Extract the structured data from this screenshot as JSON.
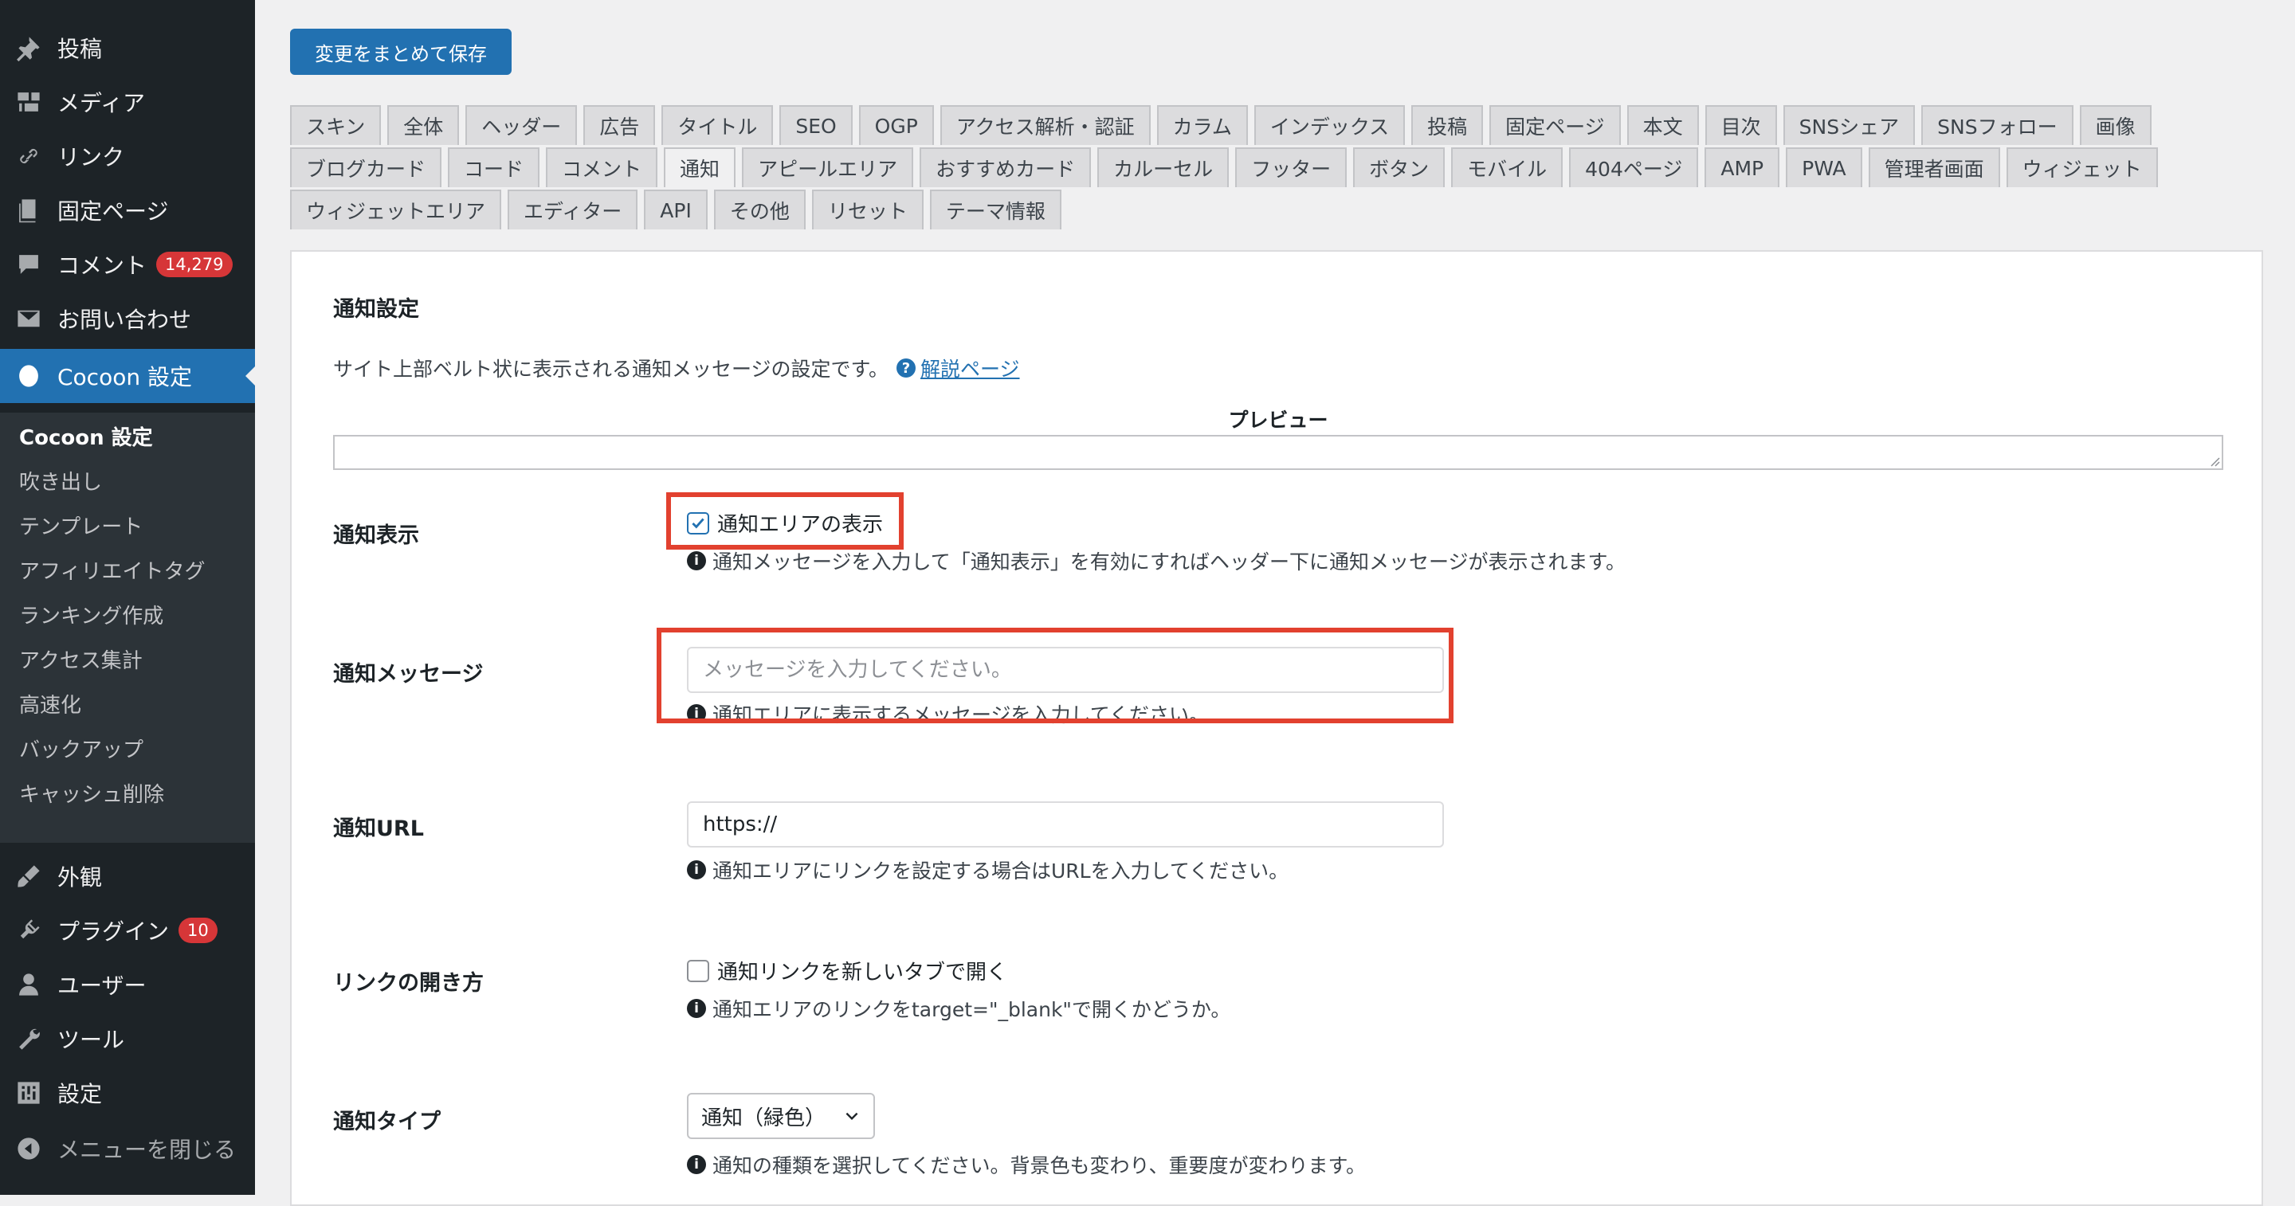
{
  "sidebar": {
    "items": [
      {
        "label": "投稿",
        "icon": "pin-icon"
      },
      {
        "label": "メディア",
        "icon": "media-icon"
      },
      {
        "label": "リンク",
        "icon": "link-icon"
      },
      {
        "label": "固定ページ",
        "icon": "page-icon"
      },
      {
        "label": "コメント",
        "icon": "comment-icon",
        "badge": "14,279"
      },
      {
        "label": "お問い合わせ",
        "icon": "mail-icon"
      },
      {
        "label": "Cocoon 設定",
        "icon": "cocoon-icon",
        "active": true
      }
    ],
    "submenu": [
      "Cocoon 設定",
      "吹き出し",
      "テンプレート",
      "アフィリエイトタグ",
      "ランキング作成",
      "アクセス集計",
      "高速化",
      "バックアップ",
      "キャッシュ削除"
    ],
    "bottom_items": [
      {
        "label": "外観",
        "icon": "brush-icon"
      },
      {
        "label": "プラグイン",
        "icon": "plugin-icon",
        "badge": "10"
      },
      {
        "label": "ユーザー",
        "icon": "user-icon"
      },
      {
        "label": "ツール",
        "icon": "wrench-icon"
      },
      {
        "label": "設定",
        "icon": "settings-icon"
      },
      {
        "label": "メニューを閉じる",
        "icon": "collapse-icon"
      }
    ]
  },
  "save_button": "変更をまとめて保存",
  "tabs": {
    "row1": [
      "スキン",
      "全体",
      "ヘッダー",
      "広告",
      "タイトル",
      "SEO",
      "OGP",
      "アクセス解析・認証",
      "カラム",
      "インデックス",
      "投稿",
      "固定ページ",
      "本文",
      "目次",
      "SNSシェア",
      "SNSフォロー",
      "画像"
    ],
    "row2": [
      "ブログカード",
      "コード",
      "コメント",
      "通知",
      "アピールエリア",
      "おすすめカード",
      "カルーセル",
      "フッター",
      "ボタン",
      "モバイル",
      "404ページ",
      "AMP",
      "PWA",
      "管理者画面",
      "ウィジェット"
    ],
    "row3": [
      "ウィジェットエリア",
      "エディター",
      "API",
      "その他",
      "リセット",
      "テーマ情報"
    ],
    "active": "通知"
  },
  "panel": {
    "title": "通知設定",
    "description": "サイト上部ベルト状に表示される通知メッセージの設定です。",
    "help_icon": "?",
    "help_link": "解説ページ",
    "preview_label": "プレビュー",
    "info_icon": "i",
    "notice_display": {
      "label": "通知表示",
      "checkbox_label": "通知エリアの表示",
      "checked": true,
      "hint": "通知メッセージを入力して「通知表示」を有効にすればヘッダー下に通知メッセージが表示されます。"
    },
    "notice_message": {
      "label": "通知メッセージ",
      "placeholder": "メッセージを入力してください。",
      "hint": "通知エリアに表示するメッセージを入力してください。"
    },
    "notice_url": {
      "label": "通知URL",
      "value": "https://",
      "hint": "通知エリアにリンクを設定する場合はURLを入力してください。"
    },
    "link_open": {
      "label": "リンクの開き方",
      "checkbox_label": "通知リンクを新しいタブで開く",
      "checked": false,
      "hint": "通知エリアのリンクをtarget=\"_blank\"で開くかどうか。"
    },
    "notice_type": {
      "label": "通知タイプ",
      "selected": "通知（緑色）",
      "hint": "通知の種類を選択してください。背景色も変わり、重要度が変わります。"
    }
  },
  "colors": {
    "sidebar_bg": "#1d2327",
    "submenu_bg": "#2c3338",
    "accent": "#2271b1",
    "badge": "#d63638",
    "highlight": "#e2412f"
  }
}
